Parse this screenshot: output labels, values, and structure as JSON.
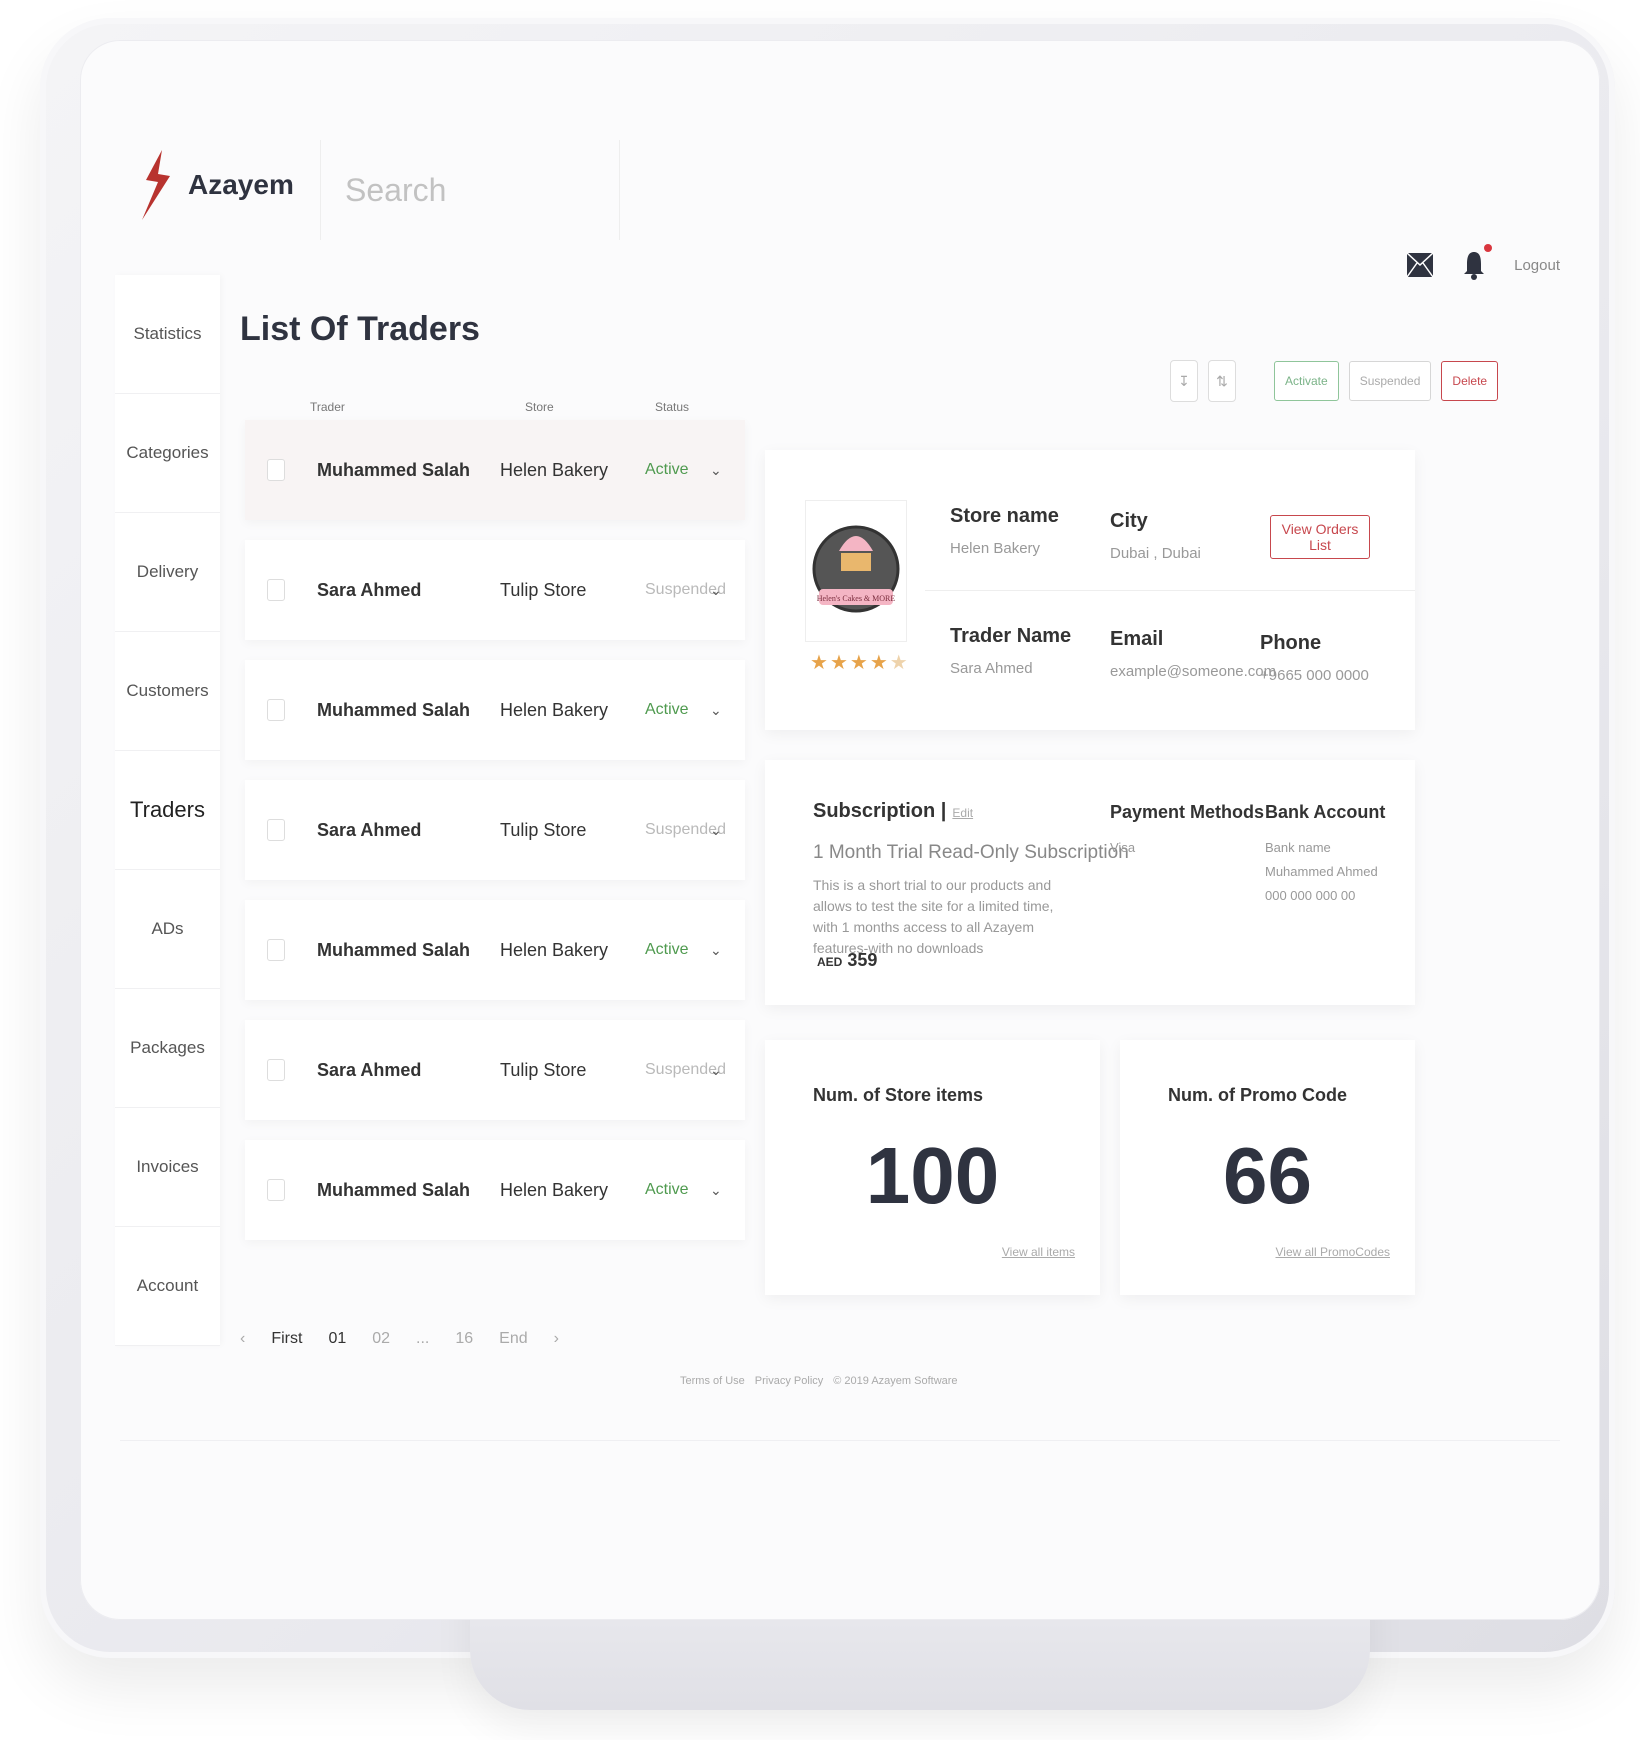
{
  "app": {
    "name": "Azayem"
  },
  "search": {
    "placeholder": "Search"
  },
  "header": {
    "logout_label": "Logout"
  },
  "sidebar": {
    "items": [
      {
        "label": "Statistics"
      },
      {
        "label": "Categories"
      },
      {
        "label": "Delivery"
      },
      {
        "label": "Customers"
      },
      {
        "label": "Traders",
        "active": true
      },
      {
        "label": "ADs"
      },
      {
        "label": "Packages"
      },
      {
        "label": "Invoices"
      },
      {
        "label": "Account"
      }
    ]
  },
  "page": {
    "title": "List Of Traders"
  },
  "table": {
    "columns": [
      "Trader",
      "Store",
      "Status"
    ],
    "rows": [
      {
        "trader": "Muhammed Salah",
        "store": "Helen Bakery",
        "status": "Active"
      },
      {
        "trader": "Sara Ahmed",
        "store": "Tulip Store",
        "status": "Suspended"
      },
      {
        "trader": "Muhammed Salah",
        "store": "Helen Bakery",
        "status": "Active"
      },
      {
        "trader": "Sara Ahmed",
        "store": "Tulip Store",
        "status": "Suspended"
      },
      {
        "trader": "Muhammed Salah",
        "store": "Helen Bakery",
        "status": "Active"
      },
      {
        "trader": "Sara Ahmed",
        "store": "Tulip Store",
        "status": "Suspended"
      },
      {
        "trader": "Muhammed Salah",
        "store": "Helen Bakery",
        "status": "Active"
      }
    ]
  },
  "pagination": {
    "first": "First",
    "pages": [
      "01",
      "02",
      "...",
      "16"
    ],
    "end": "End"
  },
  "toolbar": {
    "activate": "Activate",
    "suspended": "Suspended",
    "delete": "Delete"
  },
  "store": {
    "store_name_label": "Store name",
    "store_name": "Helen Bakery",
    "city_label": "City",
    "city": "Dubai , Dubai",
    "trader_name_label": "Trader Name",
    "trader_name": "Sara Ahmed",
    "email_label": "Email",
    "email": "example@someone.com",
    "phone_label": "Phone",
    "phone": "+9665 000 0000",
    "view_orders": "View Orders List",
    "logo_text": "Helen's Cakes & MORE",
    "rating": 4
  },
  "subscription": {
    "title": "Subscription |",
    "edit": "Edit",
    "plan": "1 Month Trial Read-Only Subscription",
    "description": "This is a short trial to our products and allows to test the site for a limited time, with 1 months access to all Azayem features-with no downloads",
    "currency": "AED",
    "price": "359",
    "payment_title": "Payment Methods",
    "payment_value": "Visa",
    "bank_title": "Bank Account",
    "bank_name": "Bank name",
    "bank_holder": "Muhammed Ahmed",
    "bank_number": "000 000 000 00"
  },
  "stats": {
    "items_label": "Num. of Store items",
    "items_value": "100",
    "items_link": "View all items",
    "promo_label": "Num. of Promo Code",
    "promo_value": "66",
    "promo_link": "View all PromoCodes"
  },
  "footer": {
    "terms": "Terms of Use",
    "privacy": "Privacy Policy",
    "copyright": "© 2019 Azayem Software"
  },
  "colors": {
    "accent": "#c7474d",
    "active": "#4f9a4f",
    "suspended": "#b9b9b9",
    "star": "#e7a34a"
  }
}
